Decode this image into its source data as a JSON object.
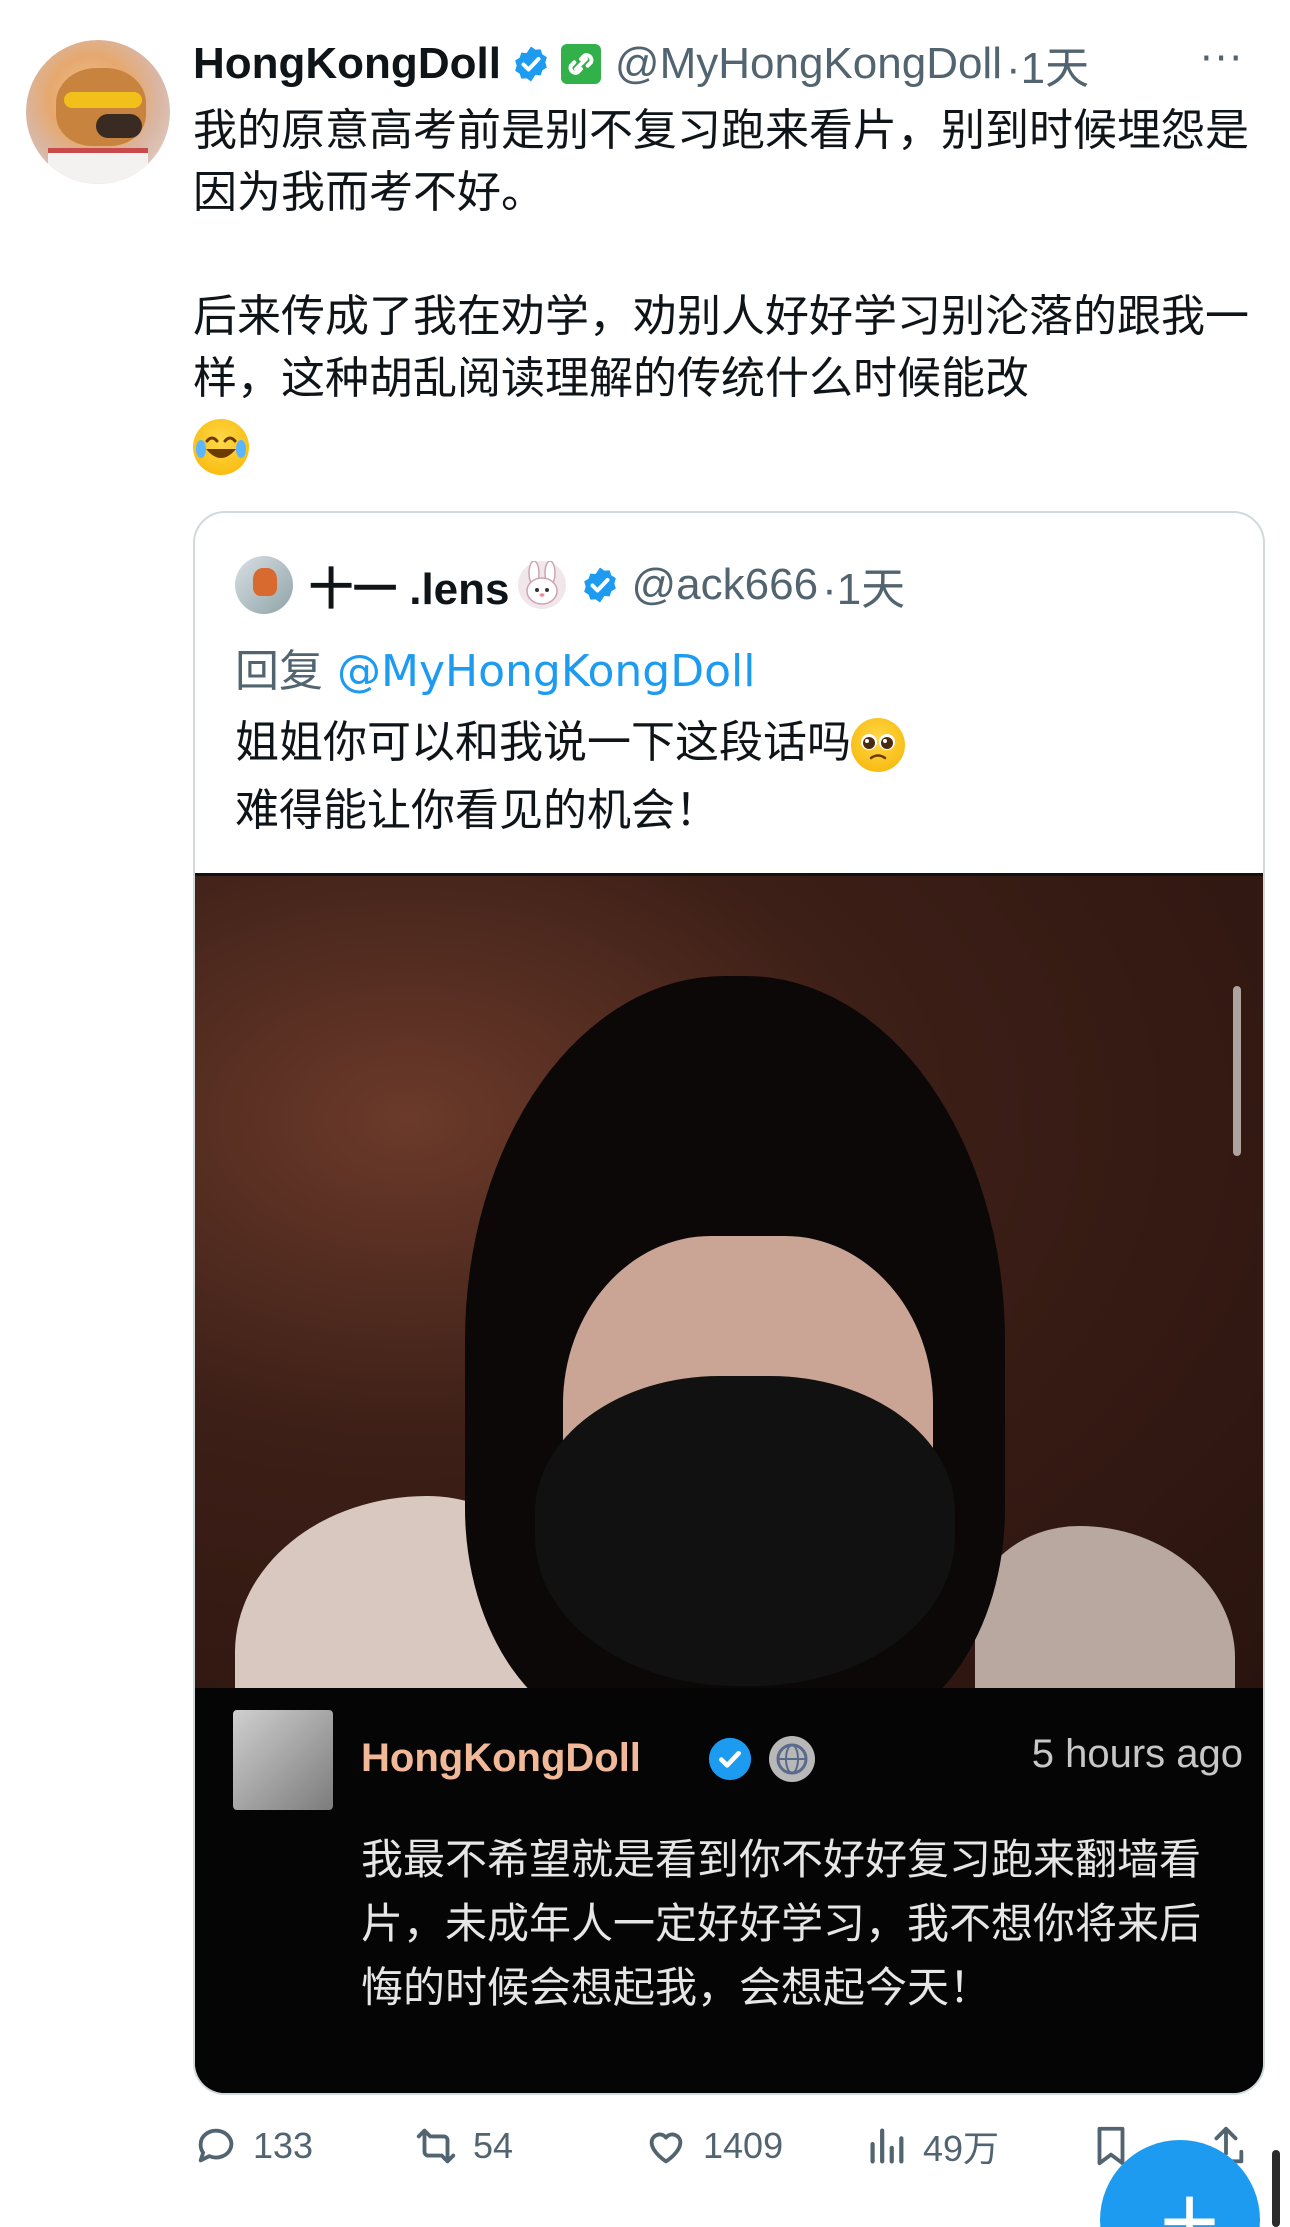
{
  "tweet": {
    "display_name": "HongKongDoll",
    "handle": "@MyHongKongDoll",
    "time": "·1天",
    "more": "···",
    "text_para1": "我的原意高考前是别不复习跑来看片，别到时候埋怨是因为我而考不好。",
    "text_para2": "后来传成了我在劝学，劝别人好好学习别沦落的跟我一样，这种胡乱阅读理解的传统什么时候能改"
  },
  "quote": {
    "display_name": "十一 .lens",
    "handle": "@ack666",
    "time": "·1天",
    "reply_prefix": "回复",
    "reply_mention": "@MyHongKongDoll",
    "line1": "姐姐你可以和我说一下这段话吗",
    "line2": "难得能让你看见的机会！"
  },
  "media_comment": {
    "name": "HongKongDoll",
    "time": "5 hours ago",
    "text": "我最不希望就是看到你不好好复习跑来翻墙看片，未成年人一定好好学习，我不想你将来后悔的时候会想起我，会想起今天！"
  },
  "actions": {
    "replies": "133",
    "retweets": "54",
    "likes": "1409",
    "views": "49万"
  },
  "fab": {
    "label": "+"
  },
  "colors": {
    "accent": "#1d9bf0",
    "muted": "#536471",
    "text": "#0f1419",
    "comment_name": "#f2b999"
  },
  "icons": {
    "verified": "verified-badge-icon",
    "more": "more-options-icon",
    "reply": "reply-icon",
    "retweet": "retweet-icon",
    "like": "heart-icon",
    "views": "views-chart-icon",
    "bookmark": "bookmark-icon",
    "share": "share-icon"
  }
}
